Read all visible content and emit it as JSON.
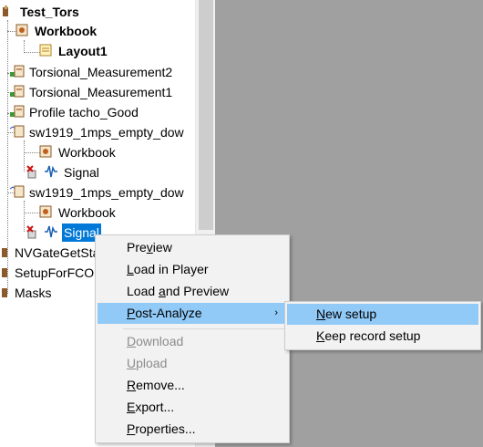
{
  "tree": {
    "root": "Test_Tors",
    "workbook": "Workbook",
    "layout1": "Layout1",
    "tm2": "Torsional_Measurement2",
    "tm1": "Torsional_Measurement1",
    "profile": "Profile tacho_Good",
    "sw1": "sw1919_1mps_empty_dow",
    "sw1_workbook": "Workbook",
    "sw1_signal": "Signal",
    "sw2": "sw1919_1mps_empty_dow",
    "sw2_workbook": "Workbook",
    "sw2_signal": "Signal",
    "nvgate": "NVGateGetSta",
    "setup": "SetupForFCO",
    "masks": "Masks"
  },
  "context_menu": {
    "preview": {
      "pre": "Pre",
      "ul": "v",
      "post": "iew"
    },
    "load_player": {
      "pre": "",
      "ul": "L",
      "post": "oad in Player"
    },
    "load_preview": {
      "pre": "Load ",
      "ul": "a",
      "post": "nd Preview"
    },
    "post_analyze": {
      "pre": "",
      "ul": "P",
      "post": "ost-Analyze"
    },
    "download": {
      "pre": "",
      "ul": "D",
      "post": "ownload"
    },
    "upload": {
      "pre": "",
      "ul": "U",
      "post": "pload"
    },
    "remove": {
      "pre": "",
      "ul": "R",
      "post": "emove..."
    },
    "export": {
      "pre": "",
      "ul": "E",
      "post": "xport..."
    },
    "properties": {
      "pre": "",
      "ul": "P",
      "post": "roperties..."
    }
  },
  "submenu": {
    "new_setup": {
      "pre": "",
      "ul": "N",
      "post": "ew setup"
    },
    "keep_record": {
      "pre": "",
      "ul": "K",
      "post": "eep record setup"
    }
  },
  "colors": {
    "selection": "#0078d7",
    "menu_highlight": "#91c9f7",
    "pane_gray": "#a0a0a0"
  }
}
